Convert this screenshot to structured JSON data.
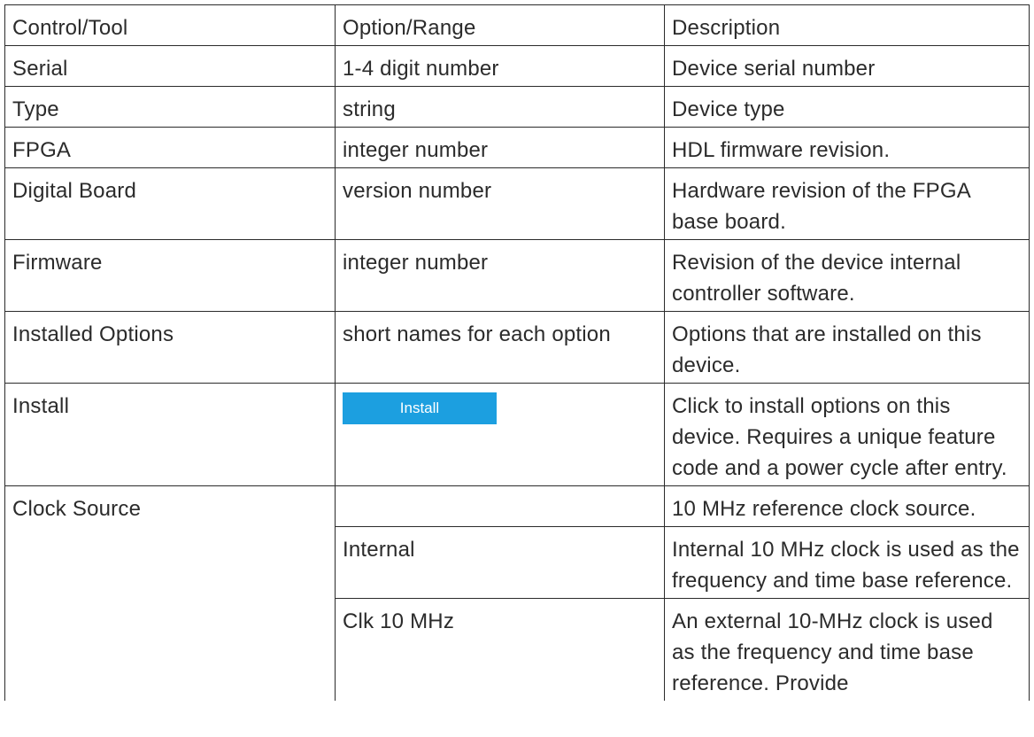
{
  "table": {
    "headers": [
      "Control/Tool",
      "Option/Range",
      "Description"
    ],
    "rows": [
      {
        "control": "Serial",
        "option": "1-4 digit number",
        "description": "Device serial number"
      },
      {
        "control": "Type",
        "option": "string",
        "description": "Device type"
      },
      {
        "control": "FPGA",
        "option": "integer number",
        "description": "HDL firmware revision."
      },
      {
        "control": "Digital Board",
        "option": "version number",
        "description": "Hardware revision of the FPGA base board."
      },
      {
        "control": "Firmware",
        "option": "integer number",
        "description": "Revision of the device internal controller software."
      },
      {
        "control": "Installed Options",
        "option": "short names for each option",
        "description": "Options that are installed on this device."
      },
      {
        "control": "Install",
        "button_label": "Install",
        "description": "Click to install options on this device. Requires a unique feature code and a power cycle after entry."
      },
      {
        "control": "Clock Source",
        "option": "",
        "description": "10 MHz reference clock source."
      },
      {
        "control": "",
        "option": "Internal",
        "description": "Internal 10 MHz clock is used as the frequency and time base reference."
      },
      {
        "control": "",
        "option": "Clk 10 MHz",
        "description": "An external 10-MHz clock is used as the frequency and time base reference. Provide"
      }
    ]
  }
}
